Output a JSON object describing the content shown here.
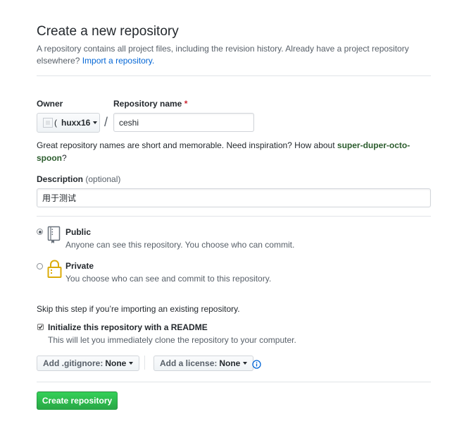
{
  "header": {
    "title": "Create a new repository",
    "subtitle": "A repository contains all project files, including the revision history. Already have a project repository elsewhere?",
    "import_link": "Import a repository."
  },
  "owner": {
    "label": "Owner",
    "username": "huxx16",
    "broken_image_text": "("
  },
  "repo_name": {
    "label": "Repository name",
    "required_mark": "*",
    "value": "ceshi"
  },
  "separator": "/",
  "hint": {
    "text": "Great repository names are short and memorable. Need inspiration? How about",
    "suggestion": "super-duper-octo-spoon",
    "end": "?"
  },
  "description": {
    "label": "Description",
    "optional": "(optional)",
    "value": "用于测试"
  },
  "visibility": {
    "options": [
      {
        "title": "Public",
        "description": "Anyone can see this repository. You choose who can commit.",
        "selected": true,
        "icon": "repo-icon"
      },
      {
        "title": "Private",
        "description": "You choose who can see and commit to this repository.",
        "selected": false,
        "icon": "lock-icon"
      }
    ]
  },
  "init": {
    "skip_text": "Skip this step if you’re importing an existing repository.",
    "readme_label": "Initialize this repository with a README",
    "readme_desc": "This will let you immediately clone the repository to your computer.",
    "readme_checked": true
  },
  "gitignore": {
    "label": "Add .gitignore:",
    "value": "None"
  },
  "license": {
    "label": "Add a license:",
    "value": "None"
  },
  "submit": {
    "label": "Create repository"
  },
  "colors": {
    "primary_green": "#28a745",
    "link_blue": "#0366d6",
    "required_red": "#cb2431",
    "lock_gold": "#dbab09"
  }
}
